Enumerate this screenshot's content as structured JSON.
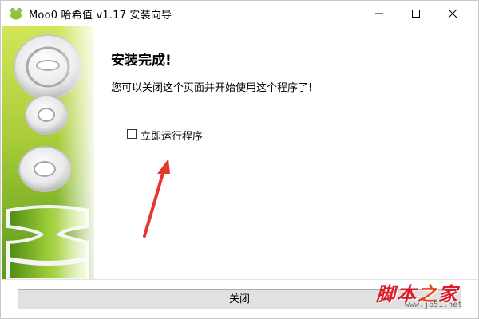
{
  "window": {
    "title": "Moo0 哈希值 v1.17 安装向导",
    "icon": "moo0-frog-icon"
  },
  "title_buttons": {
    "minimize_icon": "minimize-icon",
    "maximize_icon": "maximize-icon",
    "close_icon": "close-icon"
  },
  "banner": {
    "text": "Moo0",
    "colors": {
      "top": "#c4dd4c",
      "bottom": "#5e9a1c"
    }
  },
  "content": {
    "heading": "安装完成!",
    "message": "您可以关闭这个页面并开始使用这个程序了!",
    "run_checkbox": {
      "label": "立即运行程序",
      "checked": false
    }
  },
  "annotation": {
    "arrow_color": "#e8362f"
  },
  "footer": {
    "close_label": "关闭"
  },
  "watermark": {
    "chars": [
      "脚",
      "本",
      "之",
      "家"
    ],
    "sub": "www.jb51.net"
  }
}
